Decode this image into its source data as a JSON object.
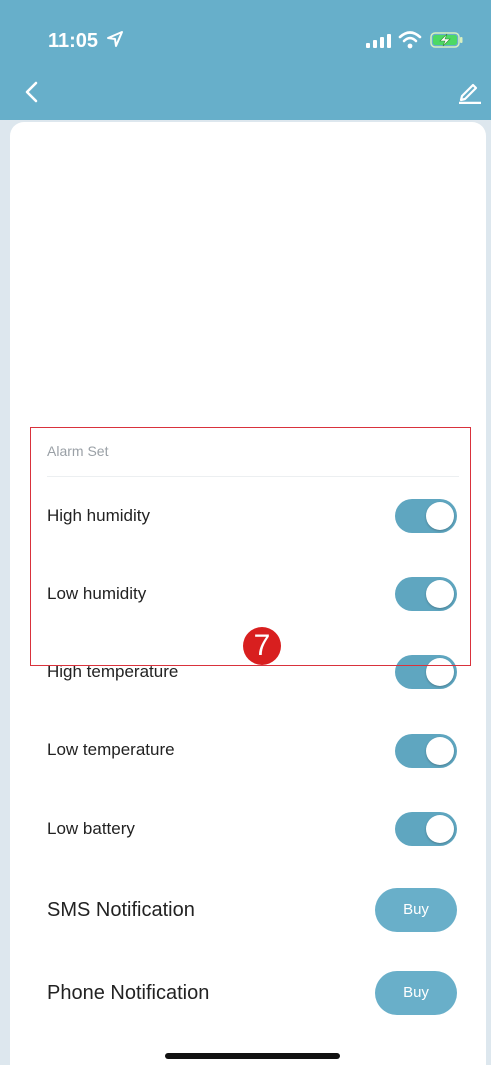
{
  "status_bar": {
    "time": "11:05"
  },
  "header": {
    "back_icon": "chevron-left-icon",
    "edit_icon": "pencil-icon"
  },
  "alarm_section": {
    "title": "Alarm Set",
    "items": [
      {
        "label": "High humidity",
        "enabled": true
      },
      {
        "label": "Low humidity",
        "enabled": true
      },
      {
        "label": "High temperature",
        "enabled": true
      },
      {
        "label": "Low temperature",
        "enabled": true
      },
      {
        "label": "Low battery",
        "enabled": true
      }
    ]
  },
  "notifications": [
    {
      "label": "SMS Notification",
      "button_label": "Buy"
    },
    {
      "label": "Phone Notification",
      "button_label": "Buy"
    }
  ],
  "annotation": {
    "badge_number": "7",
    "highlight_color": "#d9323c"
  },
  "colors": {
    "header": "#67afca",
    "toggle_on": "#5fa6c0",
    "buy_button": "#69afc9"
  }
}
